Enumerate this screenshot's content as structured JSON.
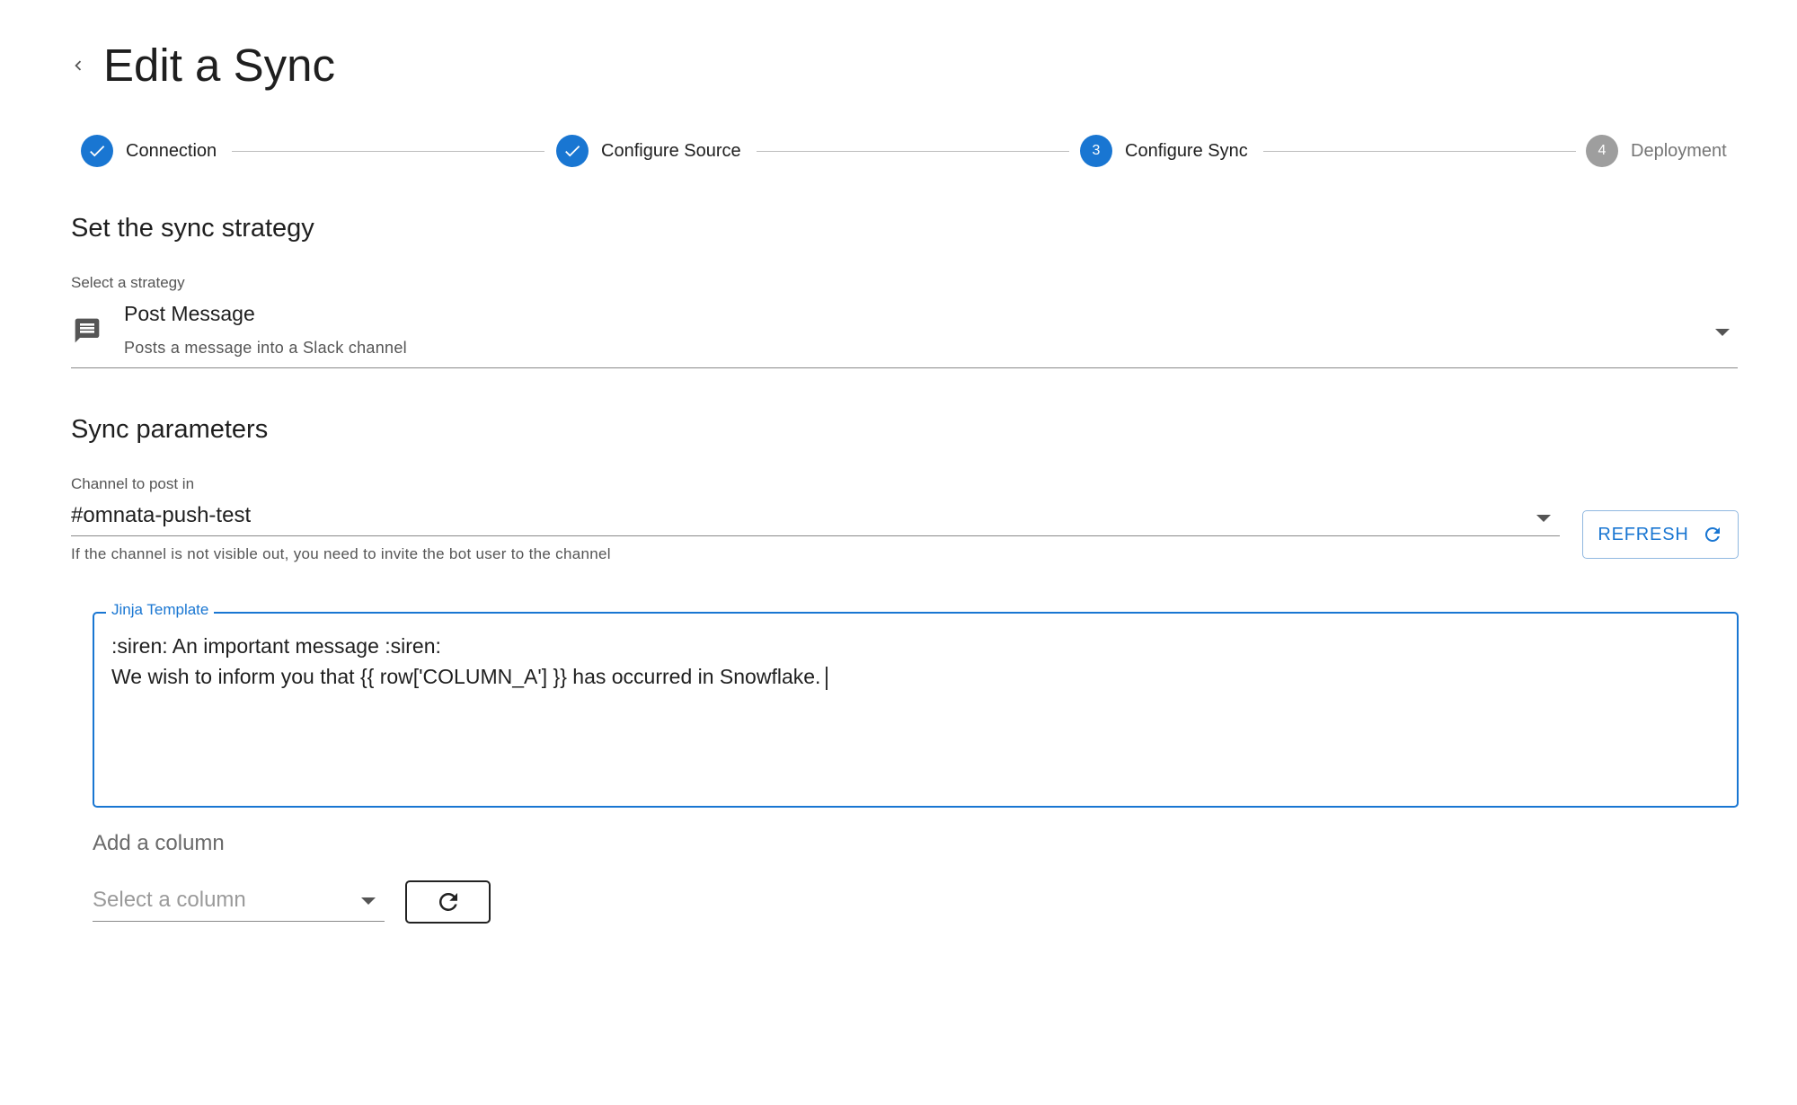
{
  "header": {
    "title": "Edit a Sync"
  },
  "stepper": {
    "steps": [
      {
        "label": "Connection",
        "state": "completed"
      },
      {
        "label": "Configure Source",
        "state": "completed"
      },
      {
        "label": "Configure Sync",
        "state": "active",
        "number": "3"
      },
      {
        "label": "Deployment",
        "state": "inactive",
        "number": "4"
      }
    ]
  },
  "strategy_section": {
    "title": "Set the sync strategy",
    "select_label": "Select a strategy",
    "selected_name": "Post Message",
    "selected_description": "Posts a message into a Slack channel",
    "icon": "message-icon"
  },
  "params_section": {
    "title": "Sync parameters",
    "channel_label": "Channel to post in",
    "channel_value": "#omnata-push-test",
    "channel_help": "If the channel is not visible out, you need to invite the bot user to the channel",
    "refresh_label": "REFRESH"
  },
  "template": {
    "legend": "Jinja Template",
    "lines": [
      ":siren: An important message :siren:",
      "We wish to inform you that {{ row['COLUMN_A'] }} has occurred in Snowflake."
    ]
  },
  "add_column": {
    "label": "Add a column",
    "placeholder": "Select a column"
  },
  "colors": {
    "primary": "#1976d2",
    "inactive_step": "#9e9e9e",
    "text": "#1f1f1f",
    "muted_text": "#555555"
  }
}
